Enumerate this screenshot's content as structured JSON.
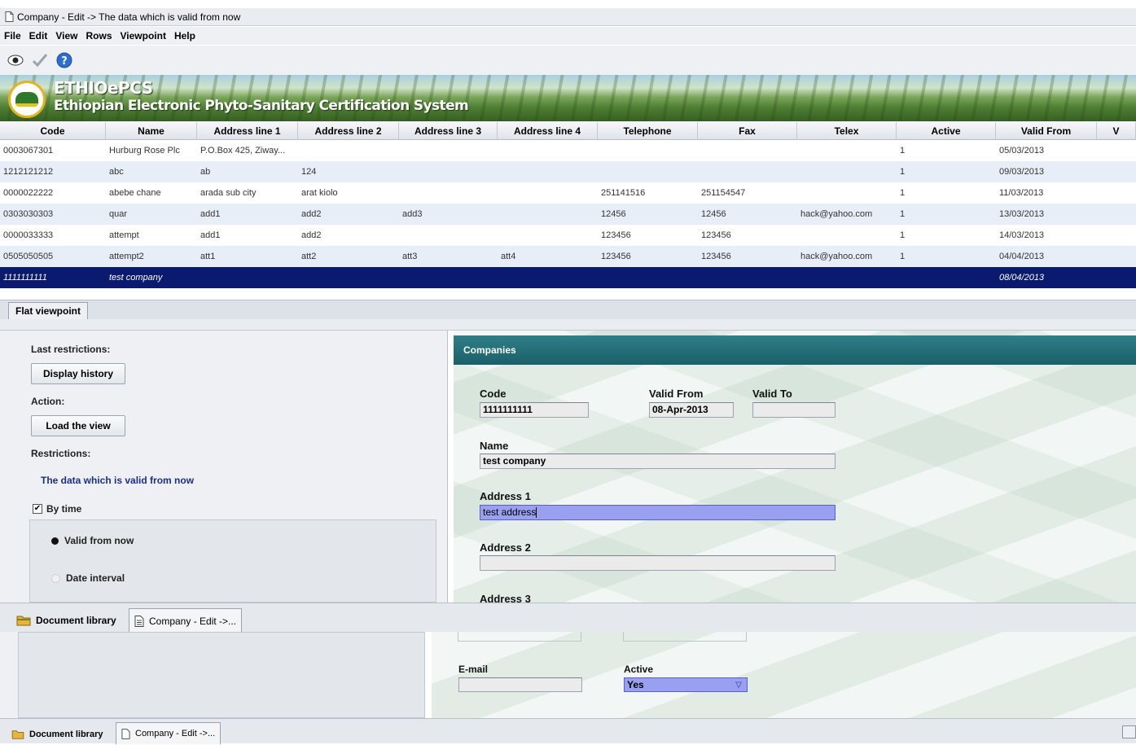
{
  "window": {
    "title": "Company - Edit -> The data which is valid from now"
  },
  "menu": [
    "File",
    "Edit",
    "View",
    "Rows",
    "Viewpoint",
    "Help"
  ],
  "toolbar": {
    "icons": [
      "eye-icon",
      "check-icon",
      "help-icon"
    ]
  },
  "banner": {
    "name": "ETHIOePCS",
    "subtitle": "Ethiopian Electronic Phyto-Sanitary Certification System"
  },
  "grid": {
    "columns": [
      "Code",
      "Name",
      "Address line 1",
      "Address line 2",
      "Address line 3",
      "Address line 4",
      "Telephone",
      "Fax",
      "Telex",
      "Active",
      "Valid From",
      "V"
    ],
    "rows": [
      [
        "0003067301",
        "Hurburg Rose Plc",
        "P.O.Box 425, Ziway...",
        "",
        "",
        "",
        "",
        "",
        "",
        "1",
        "05/03/2013"
      ],
      [
        "1212121212",
        "abc",
        "ab",
        "124",
        "",
        "",
        "",
        "",
        "",
        "1",
        "09/03/2013"
      ],
      [
        "0000022222",
        "abebe chane",
        "arada sub city",
        "arat kiolo",
        "",
        "",
        "251141516",
        "251154547",
        "",
        "1",
        "11/03/2013"
      ],
      [
        "0303030303",
        "quar",
        "add1",
        "add2",
        "add3",
        "",
        "12456",
        "12456",
        "hack@yahoo.com",
        "1",
        "13/03/2013"
      ],
      [
        "0000033333",
        "attempt",
        "add1",
        "add2",
        "",
        "",
        "123456",
        "123456",
        "",
        "1",
        "14/03/2013"
      ],
      [
        "0505050505",
        "attempt2",
        "att1",
        "att2",
        "att3",
        "att4",
        "123456",
        "123456",
        "hack@yahoo.com",
        "1",
        "04/04/2013"
      ],
      [
        "1111111111",
        "test company",
        "",
        "",
        "",
        "",
        "",
        "",
        "",
        "",
        "08/04/2013"
      ]
    ]
  },
  "viewpoint_tab": "Flat viewpoint",
  "left_panel": {
    "last_restrictions": "Last restrictions:",
    "display_history": "Display history",
    "action": "Action:",
    "load_view": "Load the view",
    "restrictions": "Restrictions:",
    "restriction_text": "The data which is valid from now",
    "by_time": "By time",
    "valid_from_now": "Valid from now",
    "date_interval": "Date interval"
  },
  "form": {
    "header": "Companies",
    "code_label": "Code",
    "code_value": "1111111111",
    "valid_from_label": "Valid From",
    "valid_from_value": "08-Apr-2013",
    "valid_to_label": "Valid To",
    "valid_to_value": "",
    "name_label": "Name",
    "name_value": "test company",
    "address1_label": "Address 1",
    "address1_value": "test address",
    "address2_label": "Address 2",
    "address2_value": "",
    "address3_label": "Address 3",
    "email_label": "E-mail",
    "email_value": "",
    "active_label": "Active",
    "active_value": "Yes"
  },
  "doc_tabs": {
    "library": "Document library",
    "edit": "Company - Edit ->..."
  },
  "colors": {
    "selection": "#0a1a6e",
    "form_header": "#1b5f69",
    "highlight_field": "#9aa0f0"
  }
}
